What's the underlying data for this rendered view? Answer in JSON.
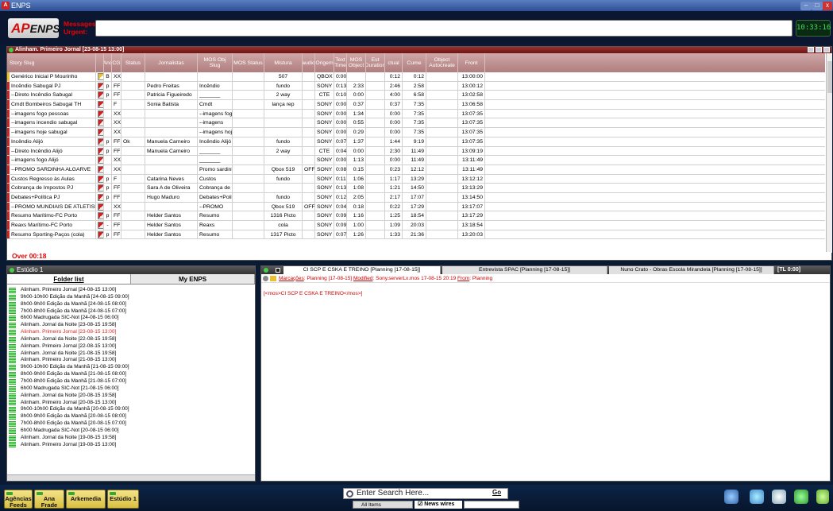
{
  "window": {
    "title": "ENPS"
  },
  "header": {
    "logo": "ENPS",
    "logo_prefix": "AP",
    "messages_label": "Messages:",
    "urgent_label": "Urgent:",
    "clock": "10:33:16"
  },
  "rundown": {
    "title": "Alinham. Primeiro Jornal [23-08-15 13:00]",
    "columns": [
      "Story Slug",
      "",
      "Anc",
      "CG",
      "Status",
      "Jornalistas",
      "MOS Obj Slug",
      "MOS Status",
      "Mistura",
      "audio",
      "Origem",
      "Text Time",
      "MOS Object",
      "Est Duration",
      "ctual",
      "Cume",
      "Object Autocreate",
      "Front"
    ],
    "rows": [
      [
        "Genérico Inicial P Mourinho",
        "y",
        "B",
        "XX",
        "",
        "",
        "",
        "",
        "507",
        "",
        "QBOX",
        "0:00",
        "",
        "",
        "0:12",
        "0:12",
        "",
        "13:00:00"
      ],
      [
        "Incêndio Sabugal PJ",
        "r",
        "p",
        "FF",
        "",
        "Pedro Freitas",
        "Incêndio",
        "",
        "fundo",
        "",
        "SONY",
        "0:13",
        "2:33",
        "",
        "2:46",
        "2:58",
        "",
        "13:00:12"
      ],
      [
        "--Direto Incêndio Sabugal",
        "r",
        "p",
        "FF",
        "",
        "Patricia Figueiredo",
        "_______",
        "",
        "2 way",
        "",
        "CTE",
        "0:10",
        "0:00",
        "",
        "4:00",
        "6:58",
        "",
        "13:02:58"
      ],
      [
        "Cmdt Bombeiros Sabugal TH",
        "r",
        "",
        "F",
        "",
        "Sonia Batista",
        "Cmdt",
        "",
        "lança rep",
        "",
        "SONY",
        "0:00",
        "0:37",
        "",
        "0:37",
        "7:35",
        "",
        "13:06:58"
      ],
      [
        "--imagens fogo pessoas",
        "r",
        "",
        "XX",
        "",
        "",
        "--imagens fogo",
        "",
        "",
        "",
        "SONY",
        "0:00",
        "1:34",
        "",
        "0:00",
        "7:35",
        "",
        "13:07:35"
      ],
      [
        "--imagens incendio sabugal",
        "r",
        "",
        "XX",
        "",
        "",
        "--imagens",
        "",
        "",
        "",
        "SONY",
        "0:00",
        "0:55",
        "",
        "0:00",
        "7:35",
        "",
        "13:07:35"
      ],
      [
        "--imagens hoje sabugal",
        "r",
        "",
        "XX",
        "",
        "",
        "--imagens hoje",
        "",
        "",
        "",
        "SONY",
        "0:00",
        "0:29",
        "",
        "0:00",
        "7:35",
        "",
        "13:07:35"
      ],
      [
        "Incêndio Alijó",
        "r",
        "p",
        "FF",
        "Ok",
        "Manuela Carneiro",
        "Incêndio Alijó",
        "",
        "fundo",
        "",
        "SONY",
        "0:07",
        "1:37",
        "",
        "1:44",
        "9:19",
        "",
        "13:07:35"
      ],
      [
        "--Direto Incêndio Alijó",
        "r",
        "p",
        "FF",
        "",
        "Manuela Carneiro",
        "_______",
        "",
        "2 way",
        "",
        "CTE",
        "0:04",
        "0:00",
        "",
        "2:30",
        "11:49",
        "",
        "13:09:19"
      ],
      [
        "--imagens fogo Alijó",
        "r",
        "",
        "XX",
        "",
        "",
        "_______",
        "",
        "",
        "",
        "SONY",
        "0:00",
        "1:13",
        "",
        "0:00",
        "11:49",
        "",
        "13:11:49"
      ],
      [
        "--PROMO SARDINHA ALGARVE",
        "r",
        "",
        "XX",
        "",
        "",
        "Promo sardinha",
        "",
        "Qbox 519",
        "OFF",
        "SONY",
        "0:08",
        "0:15",
        "",
        "0:23",
        "12:12",
        "",
        "13:11:49"
      ],
      [
        "Custos Regresso às Aulas",
        "r",
        "p",
        "F",
        "",
        "Catarina Neves",
        "Custos",
        "",
        "fundo",
        "",
        "SONY",
        "0:11",
        "1:06",
        "",
        "1:17",
        "13:29",
        "",
        "13:12:12"
      ],
      [
        "Cobrança de Impostos PJ",
        "r",
        "p",
        "FF",
        "",
        "Sara A de Oliveira",
        "Cobrança de",
        "",
        "",
        "",
        "SONY",
        "0:13",
        "1:08",
        "",
        "1:21",
        "14:50",
        "",
        "13:13:29"
      ],
      [
        "Debates+Política PJ",
        "r",
        "p",
        "FF",
        "",
        "Hugo Maduro",
        "Debates+Politic",
        "",
        "fundo",
        "",
        "SONY",
        "0:12",
        "2:05",
        "",
        "2:17",
        "17:07",
        "",
        "13:14:50"
      ],
      [
        "--PROMO MUNDIAIS DE ATLETISMO",
        "r",
        "",
        "XX",
        "",
        "",
        "--PROMO",
        "",
        "Qbox 519",
        "OFF",
        "SONY",
        "0:04",
        "0:18",
        "",
        "0:22",
        "17:29",
        "",
        "13:17:07"
      ],
      [
        "Resumo Marítimo-FC Porto",
        "r",
        "p",
        "FF",
        "",
        "Helder Santos",
        "Resumo",
        "",
        "1316 Picto",
        "",
        "SONY",
        "0:09",
        "1:16",
        "",
        "1:25",
        "18:54",
        "",
        "13:17:29"
      ],
      [
        "Reaxs Marítimo-FC Porto",
        "r",
        "-",
        "FF",
        "",
        "Helder Santos",
        "Reaxs",
        "",
        "cola",
        "",
        "SONY",
        "0:09",
        "1:00",
        "",
        "1:09",
        "20:03",
        "",
        "13:18:54"
      ],
      [
        "Resumo Sporting-Paços (cola)",
        "r",
        "p",
        "FF",
        "",
        "Helder Santos",
        "Resumo",
        "",
        "1317 Picto",
        "",
        "SONY",
        "0:07",
        "1:26",
        "",
        "1:33",
        "21:36",
        "",
        "13:20:03"
      ]
    ],
    "over_label": "Over 00:18"
  },
  "folder_panel": {
    "title": "Estúdio 1",
    "tabs": [
      "Folder list",
      "My ENPS"
    ],
    "items": [
      "Alinham. Primeiro Jornal [24-08-15 13:00]",
      "9h00-10h00 Edição da Manhã [24-08-15 09:00]",
      "8h00-9h00 Edição da Manhã [24-08-15 08:00]",
      "7h00-8h00 Edição da Manhã [24-08-15 07:00]",
      "6h00 Madrugada SIC-Not [24-08-15 06:00]",
      "Alinham. Jornal da Noite [23-08-15 19:58]",
      "Alinham. Primeiro Jornal [23-08-15 13:00]",
      "Alinham. Jornal da Noite [22-08-15 19:58]",
      "Alinham. Primeiro Jornal [22-08-15 13:00]",
      "Alinham. Jornal da Noite [21-08-15 19:58]",
      "Alinham. Primeiro Jornal [21-08-15 13:00]",
      "9h00-10h00 Edição da Manhã [21-08-15 09:00]",
      "8h00-9h00 Edição da Manhã [21-08-15 08:00]",
      "7h00-8h00 Edição da Manhã [21-08-15 07:00]",
      "6h00 Madrugada SIC-Not [21-08-15 06:00]",
      "Alinham. Jornal da Noite [20-08-15 19:58]",
      "Alinham. Primeiro Jornal [20-08-15 13:00]",
      "9h00-10h00 Edição da Manhã [20-08-15 09:00]",
      "8h00-9h00 Edição da Manhã [20-08-15 08:00]",
      "7h00-8h00 Edição da Manhã [20-08-15 07:00]",
      "6h00 Madrugada SIC-Not [20-08-15 06:00]",
      "Alinham. Jornal da Noite [19-08-15 19:58]",
      "Alinham. Primeiro Jornal [19-08-15 13:00]"
    ],
    "selected_index": 6
  },
  "story_panel": {
    "tabs": [
      "CI SCP E CSKA E TREINO [Planning [17-08-15]]",
      "Entrevista SPAC [Planning [17-08-15]]",
      "Nuno Crato - Obras Escola Mirandela [Planning [17-08-15]]"
    ],
    "tl_label": "[TL 0:00]",
    "info": {
      "marcacoes": "Marcações",
      "planning": ": Planning [17-08-15]",
      "modified_label": "Modified",
      "modified_value": ": Sony.serverLx.mos  17-08-15 20:19",
      "from_label": "From",
      "from_value": ": Planning"
    },
    "body": "[<mos>CI SCP  E CSKA E TREINO</mos>]"
  },
  "taskbar": {
    "buttons": [
      "Agências Feeds",
      "Ana Frade",
      "Arkemedia",
      "Estúdio 1"
    ],
    "search_placeholder": "Enter Search Here...",
    "go_label": "Go",
    "all_items": "All Items",
    "news_wires": "News wires"
  },
  "colors": {
    "rundown_header": "#7a1e1e",
    "accent_red": "#d01010",
    "clock_green": "#3fdf5a"
  }
}
